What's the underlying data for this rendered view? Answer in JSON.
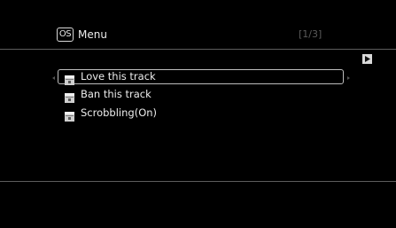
{
  "header": {
    "badge": "OS",
    "title": "Menu",
    "page_indicator": "[1/3]"
  },
  "menu": {
    "items": [
      {
        "label": "Love this track",
        "icon": "folder-icon",
        "selected": true
      },
      {
        "label": "Ban this track",
        "icon": "folder-icon",
        "selected": false
      },
      {
        "label": "Scrobbling(On)",
        "icon": "folder-icon",
        "selected": false
      }
    ]
  },
  "controls": {
    "play_icon": "play-icon"
  },
  "colors": {
    "background": "#000000",
    "text": "#ededed",
    "dim_text": "#5a5a5a",
    "rule": "#5c5c5c",
    "selection_border": "#bdbdbd"
  }
}
